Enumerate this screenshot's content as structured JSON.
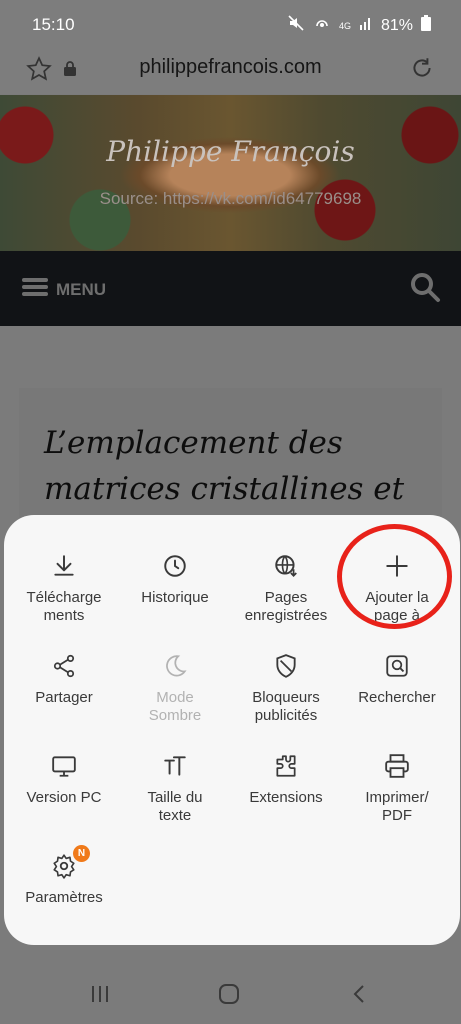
{
  "status": {
    "time": "15:10",
    "battery": "81%",
    "network": "4G"
  },
  "browser": {
    "url": "philippefrancois.com"
  },
  "site": {
    "title": "Philippe François",
    "source": "Source: https://vk.com/id64779698",
    "menu_label": "MENU",
    "heading": "L’emplacement des matrices cristallines et"
  },
  "menu": {
    "downloads": "Téléchargements",
    "history": "Historique",
    "saved_pages": "Pages enregistrées",
    "add_page": "Ajouter la page à",
    "share": "Partager",
    "dark_mode": "Mode Sombre",
    "ad_blockers": "Bloqueurs publicités",
    "find": "Rechercher",
    "desktop_version": "Version PC",
    "text_size": "Taille du texte",
    "extensions": "Extensions",
    "print_pdf": "Imprimer/ PDF",
    "settings": "Paramètres",
    "settings_badge": "N"
  },
  "colors": {
    "accent_badge": "#f07a1a",
    "highlight_ring": "#e8221a",
    "nav_dark": "#111316"
  }
}
